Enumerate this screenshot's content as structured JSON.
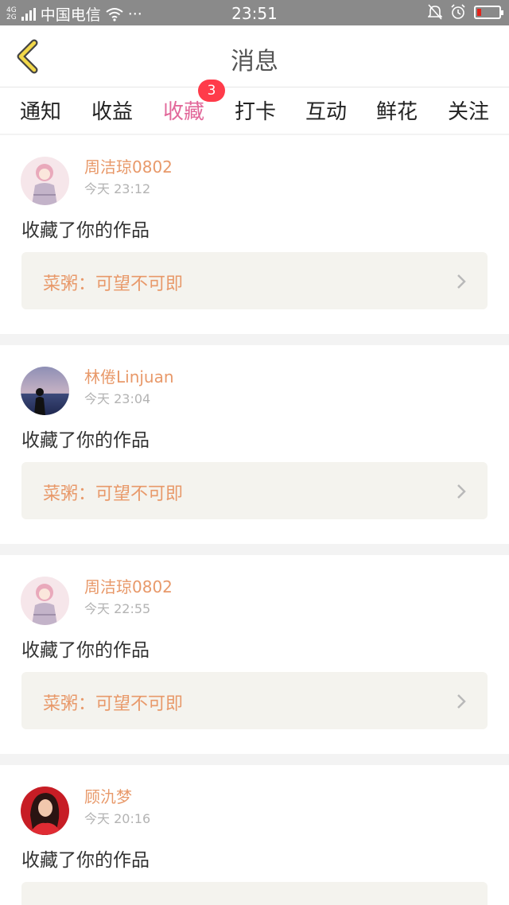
{
  "status_bar": {
    "network_top": "4G",
    "network_bottom": "2G",
    "carrier": "中国电信",
    "more": "···",
    "time": "23:51"
  },
  "header": {
    "title": "消息"
  },
  "tabs": [
    {
      "label": "通知"
    },
    {
      "label": "收益"
    },
    {
      "label": "收藏",
      "active": true
    },
    {
      "label": "打卡"
    },
    {
      "label": "互动"
    },
    {
      "label": "鲜花"
    },
    {
      "label": "关注"
    }
  ],
  "badge": {
    "count": "3"
  },
  "messages": [
    {
      "user": "周洁琼0802",
      "time": "今天 23:12",
      "action": "收藏了你的作品",
      "work": "菜粥：可望不可即"
    },
    {
      "user": "林倦Linjuan",
      "time": "今天 23:04",
      "action": "收藏了你的作品",
      "work": "菜粥：可望不可即"
    },
    {
      "user": "周洁琼0802",
      "time": "今天 22:55",
      "action": "收藏了你的作品",
      "work": "菜粥：可望不可即"
    },
    {
      "user": "顾氿梦",
      "time": "今天 20:16",
      "action": "收藏了你的作品",
      "work": ""
    }
  ],
  "colors": {
    "accent_pink": "#e2689a",
    "name_orange": "#e8996a",
    "badge_red": "#ff3b4a",
    "back_arrow": "#f2d84a"
  }
}
